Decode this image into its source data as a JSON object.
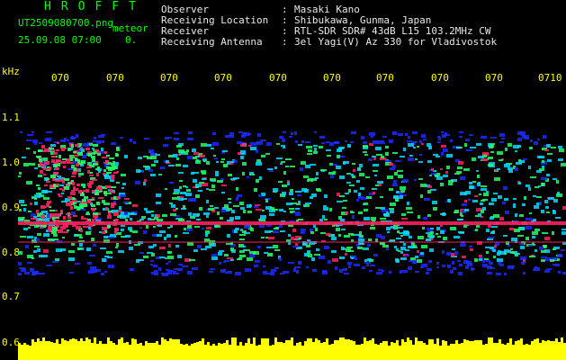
{
  "header": {
    "brand": "HROFFT",
    "filename": "UT2509080700.png",
    "meteor_label": "meteor",
    "datetime": "25.09.08 07:00",
    "counter": "0."
  },
  "info": [
    {
      "label": "Observer",
      "sep": ":",
      "value": "Masaki Kano"
    },
    {
      "label": "Receiving Location",
      "sep": ":",
      "value": "Shibukawa, Gunma, Japan"
    },
    {
      "label": "Receiver",
      "sep": ":",
      "value": "RTL-SDR SDR# 43dB L15 103.2MHz CW"
    },
    {
      "label": "Receiving Antenna",
      "sep": ":",
      "value": "3el Yagi(V) Az 330 for Vladivostok"
    }
  ],
  "axis": {
    "unit": "kHz",
    "time_ticks": [
      "070",
      "070",
      "070",
      "070",
      "070",
      "070",
      "070",
      "070",
      "070",
      "0710"
    ],
    "freq_ticks": [
      "1.1",
      "1.0",
      "0.9",
      "0.8",
      "0.7",
      "0.6"
    ]
  },
  "colors": {
    "background": "#000000",
    "label_yellow": "#ffff00",
    "header_green": "#00ff00",
    "spectrum_blue": "#1a2cff",
    "spectrum_cyan": "#00d8ff",
    "spectrum_green": "#22ff66",
    "spectrum_red": "#ff2060",
    "bottom_band": "#ffff00"
  }
}
